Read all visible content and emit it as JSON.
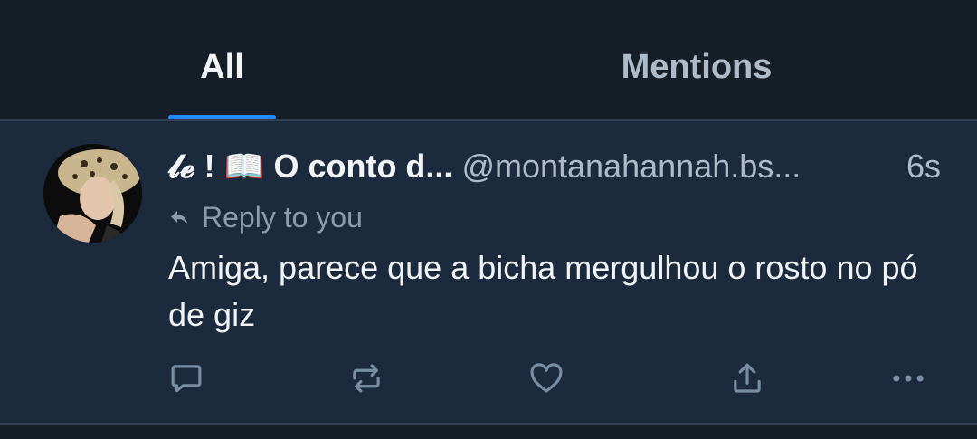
{
  "tabs": [
    {
      "label": "All",
      "active": true
    },
    {
      "label": "Mentions",
      "active": false
    }
  ],
  "notification": {
    "display_name": "𝓵𝓮 ! 📖 O conto d...",
    "handle": "@montanahannah.bs...",
    "timestamp": "6s",
    "reply_label": "Reply to you",
    "text": "Amiga, parece que a bicha mergulhou o rosto no pó de giz"
  },
  "actions": [
    "reply-icon",
    "repost-icon",
    "like-icon",
    "share-icon",
    "more-icon"
  ],
  "colors": {
    "background": "#161e27",
    "notification_bg": "#1b2a3d",
    "accent": "#208bfe",
    "text_primary": "#f1f3f5",
    "text_secondary": "#aebbc9"
  }
}
